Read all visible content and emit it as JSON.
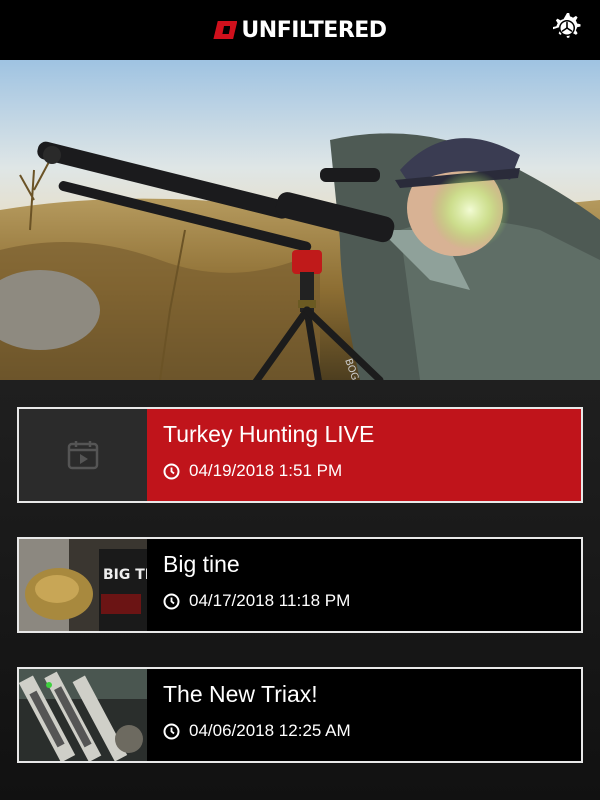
{
  "header": {
    "logo_text": "UNFILTERED",
    "brand_color": "#d0101c",
    "settings_icon": "gear-icon"
  },
  "hero": {
    "image": "hunter-with-rifle-on-bog-pod-tripod",
    "tripod_label": "BOG-POD"
  },
  "videos": [
    {
      "title": "Turkey Hunting LIVE",
      "date": "04/19/2018 1:51 PM",
      "thumbnail": "calendar-video-icon",
      "active": true
    },
    {
      "title": "Big tine",
      "date": "04/17/2018 11:18 PM",
      "thumbnail": "big-tine-feed-bag"
    },
    {
      "title": "The New Triax!",
      "date": "04/06/2018 12:25 AM",
      "thumbnail": "triax-tree-stand"
    }
  ],
  "colors": {
    "active_card": "#c0141b",
    "card_border": "#e8e8e8"
  }
}
